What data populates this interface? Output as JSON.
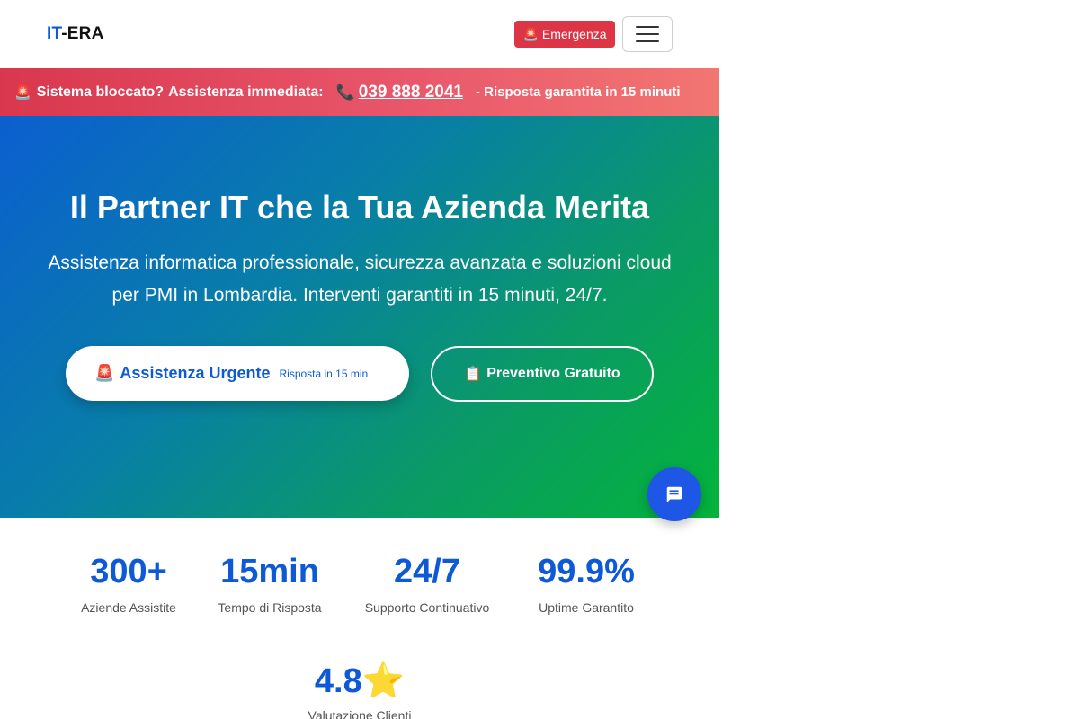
{
  "header": {
    "logo_prefix": "IT",
    "logo_suffix": "-ERA",
    "emergency_icon": "🚨",
    "emergency_label": "Emergenza",
    "menu_icon": "hamburger-icon"
  },
  "alert": {
    "icon": "🚨",
    "strong": "Sistema bloccato?",
    "normal": "Assistenza immediata:",
    "phone_icon": "📞",
    "phone": "039 888 2041",
    "tail": "- Risposta garantita in 15 minuti"
  },
  "hero": {
    "title": "Il Partner IT che la Tua Azienda Merita",
    "subtitle": "Assistenza informatica professionale, sicurezza avanzata e soluzioni cloud per PMI in Lombardia. Interventi garantiti in 15 minuti, 24/7.",
    "urgent_icon": "🚨",
    "urgent_label": "Assistenza Urgente",
    "urgent_sub": "Risposta in 15 min",
    "quote_icon": "📋",
    "quote_label": "Preventivo Gratuito"
  },
  "chat": {
    "icon": "chat-icon"
  },
  "stats": [
    {
      "value": "300+",
      "label": "Aziende Assistite"
    },
    {
      "value": "15min",
      "label": "Tempo di Risposta"
    },
    {
      "value": "24/7",
      "label": "Supporto Continuativo"
    },
    {
      "value": "99.9%",
      "label": "Uptime Garantito"
    }
  ],
  "rating": {
    "value": "4.8",
    "star": "⭐",
    "label": "Valutazione Clienti"
  },
  "colors": {
    "brand_blue": "#0d59d6",
    "emergency_red": "#dc3545",
    "hero_start": "#0b5fd0",
    "hero_end": "#03b43a",
    "chat_fab": "#1e56e6"
  }
}
